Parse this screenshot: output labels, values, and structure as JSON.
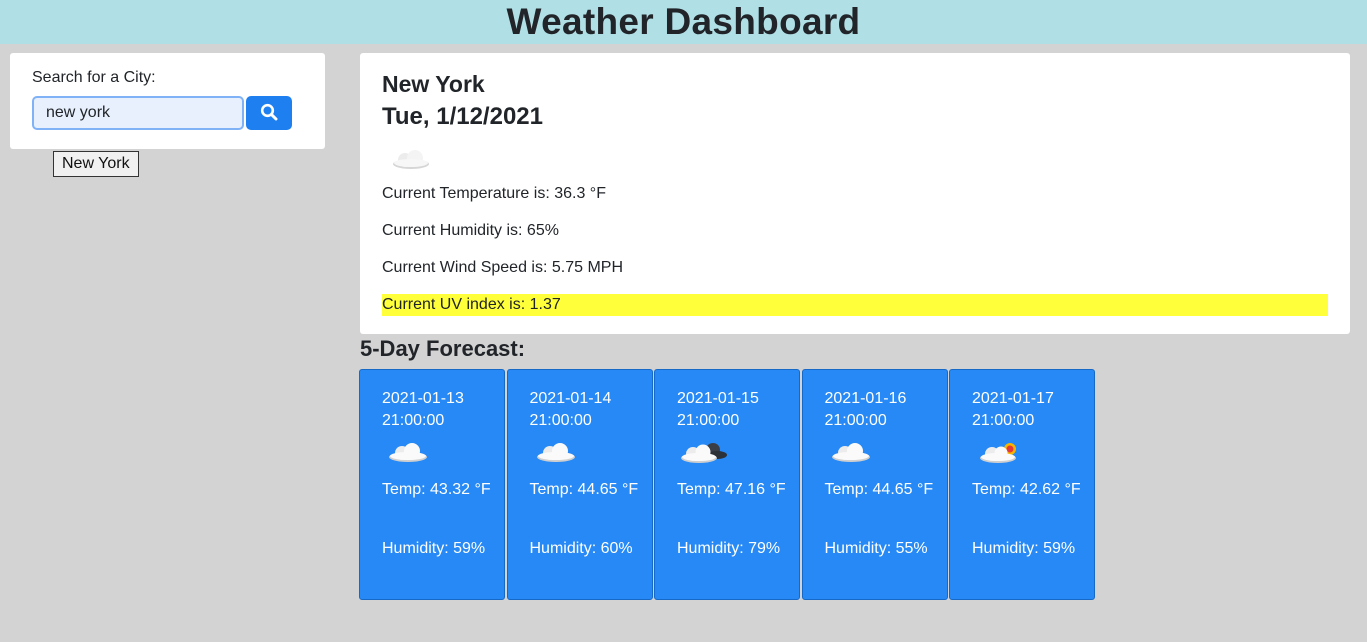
{
  "header": {
    "title": "Weather Dashboard"
  },
  "search": {
    "label": "Search for a City:",
    "value": "new york",
    "button_icon": "search-icon",
    "history": [
      "New York"
    ]
  },
  "current": {
    "city": "New York",
    "date": "Tue, 1/12/2021",
    "icon": "cloud-icon",
    "temperature": "Current Temperature is: 36.3 °F",
    "humidity": "Current Humidity is: 65%",
    "wind": "Current Wind Speed is: 5.75 MPH",
    "uv": "Current UV index is: 1.37",
    "uv_color": "#ffff3a"
  },
  "forecast": {
    "title": "5-Day Forecast:",
    "days": [
      {
        "date": "2021-01-13 21:00:00",
        "icon": "cloud-icon",
        "temp": "Temp: 43.32 °F",
        "humidity": "Humidity: 59%"
      },
      {
        "date": "2021-01-14 21:00:00",
        "icon": "cloud-icon",
        "temp": "Temp: 44.65 °F",
        "humidity": "Humidity: 60%"
      },
      {
        "date": "2021-01-15 21:00:00",
        "icon": "dark-cloud-icon",
        "temp": "Temp: 47.16 °F",
        "humidity": "Humidity: 79%"
      },
      {
        "date": "2021-01-16 21:00:00",
        "icon": "cloud-icon",
        "temp": "Temp: 44.65 °F",
        "humidity": "Humidity: 55%"
      },
      {
        "date": "2021-01-17 21:00:00",
        "icon": "cloud-sun-icon",
        "temp": "Temp: 42.62 °F",
        "humidity": "Humidity: 59%"
      }
    ],
    "card_color": "#2689f5"
  },
  "colors": {
    "header_bg": "#b0e0e6",
    "page_bg": "#d3d3d3",
    "accent": "#1e7ff0"
  }
}
